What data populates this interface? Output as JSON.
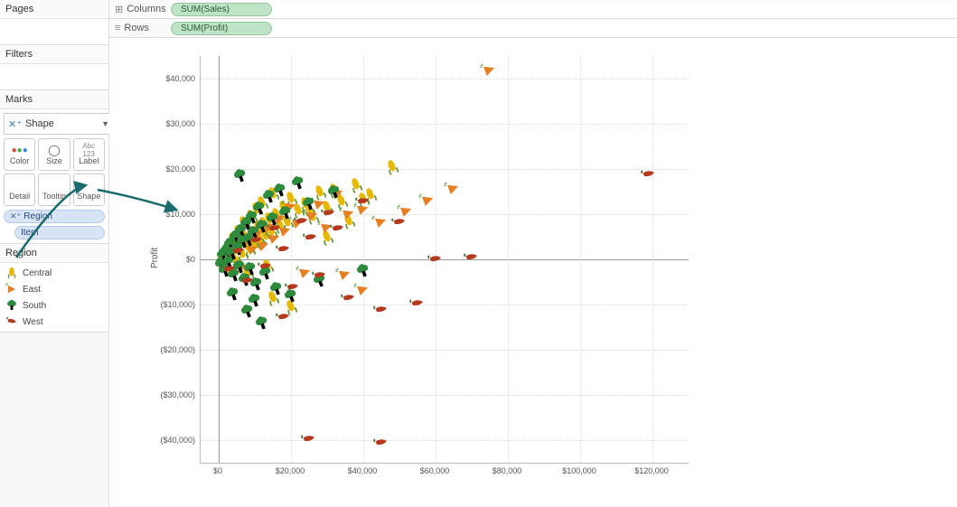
{
  "sidebar": {
    "pages_title": "Pages",
    "filters_title": "Filters",
    "marks_title": "Marks",
    "mark_type": "Shape",
    "mark_buttons": [
      "Color",
      "Size",
      "Label",
      "Detail",
      "Tooltip",
      "Shape"
    ],
    "shape_pill_prefix": "✕⁺",
    "shape_pill": "Region",
    "detail_pill": "Item",
    "legend_title": "Region",
    "legend_items": [
      {
        "label": "Central",
        "shape": "corn",
        "color": "#e6b800"
      },
      {
        "label": "East",
        "shape": "carrot",
        "color": "#e67e22"
      },
      {
        "label": "South",
        "shape": "broccoli",
        "color": "#2e8b3d"
      },
      {
        "label": "West",
        "shape": "chili",
        "color": "#b33a1f"
      }
    ]
  },
  "shelves": {
    "columns_label": "Columns",
    "columns_pill": "SUM(Sales)",
    "rows_label": "Rows",
    "rows_pill": "SUM(Profit)"
  },
  "chart_data": {
    "type": "scatter",
    "xlabel": "",
    "ylabel": "Profit",
    "xlim": [
      -5000,
      130000
    ],
    "ylim": [
      -45000,
      45000
    ],
    "xticks": [
      0,
      20000,
      40000,
      60000,
      80000,
      100000,
      120000
    ],
    "xtick_labels": [
      "$0",
      "$20,000",
      "$40,000",
      "$60,000",
      "$80,000",
      "$100,000",
      "$120,000"
    ],
    "yticks": [
      -40000,
      -30000,
      -20000,
      -10000,
      0,
      10000,
      20000,
      30000,
      40000
    ],
    "ytick_labels": [
      "($40,000)",
      "($30,000)",
      "($20,000)",
      "($10,000)",
      "$0",
      "$10,000",
      "$20,000",
      "$30,000",
      "$40,000"
    ],
    "series": [
      {
        "name": "Central",
        "shape": "corn",
        "color": "#e6b800",
        "points": [
          [
            1000,
            -1000
          ],
          [
            1500,
            500
          ],
          [
            2000,
            1500
          ],
          [
            2500,
            -2000
          ],
          [
            3000,
            3000
          ],
          [
            3500,
            800
          ],
          [
            4000,
            4500
          ],
          [
            4500,
            2000
          ],
          [
            5000,
            -500
          ],
          [
            5500,
            6000
          ],
          [
            6000,
            3500
          ],
          [
            6500,
            1200
          ],
          [
            7000,
            8000
          ],
          [
            7500,
            4800
          ],
          [
            8000,
            -3000
          ],
          [
            8500,
            2200
          ],
          [
            9000,
            9500
          ],
          [
            9500,
            5800
          ],
          [
            10000,
            3200
          ],
          [
            10500,
            11000
          ],
          [
            11000,
            6800
          ],
          [
            11500,
            4200
          ],
          [
            12000,
            12500
          ],
          [
            12500,
            7800
          ],
          [
            13000,
            5200
          ],
          [
            13500,
            -1500
          ],
          [
            14000,
            8800
          ],
          [
            14500,
            6200
          ],
          [
            15000,
            14500
          ],
          [
            16000,
            9800
          ],
          [
            17000,
            7500
          ],
          [
            18000,
            11500
          ],
          [
            19000,
            8200
          ],
          [
            20000,
            13500
          ],
          [
            22000,
            10800
          ],
          [
            24000,
            12200
          ],
          [
            26000,
            9500
          ],
          [
            28000,
            14800
          ],
          [
            30000,
            11500
          ],
          [
            32000,
            15200
          ],
          [
            34000,
            12800
          ],
          [
            38000,
            16500
          ],
          [
            42000,
            14200
          ],
          [
            48000,
            20500
          ],
          [
            36000,
            8500
          ],
          [
            40000,
            13200
          ],
          [
            30000,
            4800
          ],
          [
            25000,
            11200
          ],
          [
            15000,
            -8500
          ],
          [
            20000,
            -10500
          ]
        ]
      },
      {
        "name": "East",
        "shape": "carrot",
        "color": "#e67e22",
        "points": [
          [
            2000,
            -800
          ],
          [
            3500,
            1200
          ],
          [
            5000,
            2800
          ],
          [
            6500,
            -1500
          ],
          [
            8000,
            4200
          ],
          [
            9500,
            2500
          ],
          [
            11000,
            5800
          ],
          [
            12500,
            3200
          ],
          [
            14000,
            7500
          ],
          [
            15500,
            4800
          ],
          [
            17000,
            9200
          ],
          [
            18500,
            6500
          ],
          [
            20000,
            11800
          ],
          [
            22000,
            8200
          ],
          [
            24000,
            -2800
          ],
          [
            26000,
            9800
          ],
          [
            28000,
            12500
          ],
          [
            30000,
            7200
          ],
          [
            33000,
            14800
          ],
          [
            36000,
            10200
          ],
          [
            40000,
            -6500
          ],
          [
            45000,
            8500
          ],
          [
            52000,
            10800
          ],
          [
            58000,
            13200
          ],
          [
            65000,
            15800
          ],
          [
            75000,
            42000
          ],
          [
            35000,
            -3200
          ],
          [
            40000,
            11200
          ]
        ]
      },
      {
        "name": "South",
        "shape": "broccoli",
        "color": "#2e8b3d",
        "points": [
          [
            800,
            -1200
          ],
          [
            1200,
            800
          ],
          [
            1800,
            -2500
          ],
          [
            2200,
            1800
          ],
          [
            2800,
            -800
          ],
          [
            3200,
            3200
          ],
          [
            3800,
            1200
          ],
          [
            4200,
            -3500
          ],
          [
            4800,
            4800
          ],
          [
            5200,
            2200
          ],
          [
            5800,
            -1800
          ],
          [
            6200,
            6200
          ],
          [
            6800,
            3800
          ],
          [
            7200,
            -4500
          ],
          [
            7800,
            7800
          ],
          [
            8200,
            4200
          ],
          [
            8800,
            -2200
          ],
          [
            9200,
            9200
          ],
          [
            9800,
            5800
          ],
          [
            10500,
            -5500
          ],
          [
            11200,
            11200
          ],
          [
            12000,
            7200
          ],
          [
            13000,
            -3200
          ],
          [
            14000,
            13800
          ],
          [
            15000,
            8800
          ],
          [
            16000,
            -6500
          ],
          [
            17000,
            15200
          ],
          [
            18500,
            10200
          ],
          [
            20000,
            -8200
          ],
          [
            22000,
            16800
          ],
          [
            25000,
            12200
          ],
          [
            28000,
            -4800
          ],
          [
            32000,
            14800
          ],
          [
            6000,
            18500
          ],
          [
            8000,
            -11500
          ],
          [
            12000,
            -14200
          ],
          [
            4000,
            -7800
          ],
          [
            10000,
            -9200
          ],
          [
            40000,
            -2500
          ]
        ]
      },
      {
        "name": "West",
        "shape": "chili",
        "color": "#b33a1f",
        "points": [
          [
            3000,
            -2200
          ],
          [
            5500,
            1800
          ],
          [
            8000,
            -4800
          ],
          [
            10500,
            4200
          ],
          [
            13000,
            -1500
          ],
          [
            15500,
            6800
          ],
          [
            18000,
            2200
          ],
          [
            20500,
            -6200
          ],
          [
            23000,
            8500
          ],
          [
            25500,
            4800
          ],
          [
            28000,
            -3500
          ],
          [
            30500,
            10200
          ],
          [
            33000,
            6800
          ],
          [
            36000,
            -8500
          ],
          [
            40000,
            12800
          ],
          [
            45000,
            -11200
          ],
          [
            50000,
            8200
          ],
          [
            55000,
            -9800
          ],
          [
            60000,
            0
          ],
          [
            70000,
            500
          ],
          [
            119000,
            18800
          ],
          [
            25000,
            -39800
          ],
          [
            45000,
            -40500
          ],
          [
            18000,
            -12800
          ]
        ]
      }
    ]
  }
}
